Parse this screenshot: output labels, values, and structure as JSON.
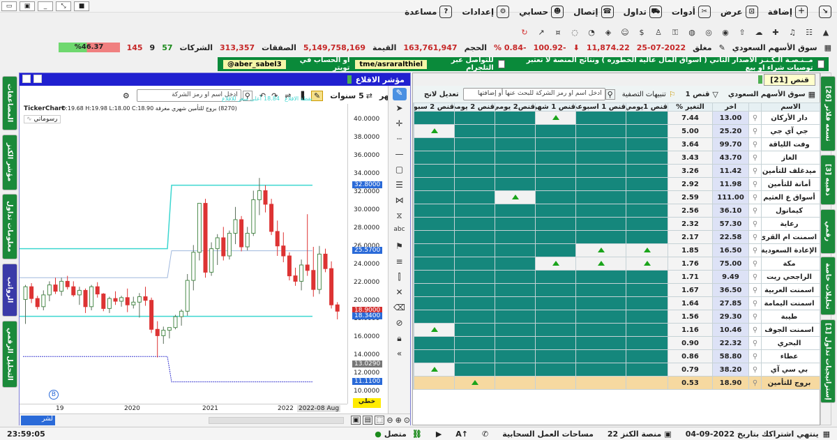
{
  "menu": [
    {
      "label": "إضافة",
      "icon": "add-icon"
    },
    {
      "label": "عرض",
      "icon": "view-icon"
    },
    {
      "label": "أدوات",
      "icon": "tools-icon"
    },
    {
      "label": "تداول",
      "icon": "cart-icon"
    },
    {
      "label": "إتصال",
      "icon": "phone-icon"
    },
    {
      "label": "حسابي",
      "icon": "user-icon"
    },
    {
      "label": "إعدادات",
      "icon": "gear-icon"
    },
    {
      "label": "مساعدة",
      "icon": "help-icon"
    }
  ],
  "market": {
    "name": "سوق الأسهم السعودي",
    "status": "مغلق",
    "date": "25-07-2022",
    "index": "11,874.22",
    "change": "-100.92",
    "change_pct": "-0.84 %",
    "volume_label": "الحجم",
    "volume": "163,761,947",
    "value_label": "القيمة",
    "value": "5,149,758,169",
    "trades_label": "الصفقات",
    "trades": "313,357",
    "companies_label": "الشركات",
    "up": "57",
    "flat": "9",
    "down": "145",
    "ratio": "%46.37"
  },
  "banner": {
    "text1": "مــنـصـة الـكـنـز الاصدار الثاني ( أسواق المال عالية الخطوره ) ونتائج المنصة لا تعتبر توصيات شراء او بيع",
    "text2": "للتواصل عبر التلجرام",
    "tg": "tme/asraralthiel",
    "text3": "او الحساب في تويتر",
    "tw": "aber_sabel3@"
  },
  "left_tabs": [
    "المضاعفات",
    "مؤشر الكنز",
    "معلومات تداول",
    "الرواتب",
    "التحليل الرقمي"
  ],
  "right_tabs": [
    "تسعه فلاتر [26]",
    "ذهبيه [3]",
    "رقمي",
    "تحليلات خاصة",
    "إستراتيجيات تداول [1]"
  ],
  "chart": {
    "title": "مؤشر الاقلاع",
    "search_placeholder": "ادخل اسم او رمز الشركة",
    "period_label": "5 سنوات",
    "interval_label": "شهر",
    "info": "(8270) بروج للتأمين شهري مغرقة O:19.68 H:19.98 L:18.00 C:18.90",
    "brand": "TickerChart",
    "legend": "رسوماتي",
    "ind_labels": [
      "أعلى سعر للاقلاع",
      "نقطة الاقلاع",
      "18.84"
    ],
    "y_ticks": [
      "40.0000",
      "38.0000",
      "36.0000",
      "34.0000",
      "32.0000",
      "30.0000",
      "28.0000",
      "26.0000",
      "24.0000",
      "22.0000",
      "20.0000",
      "18.0000",
      "16.0000",
      "14.0000",
      "12.0000",
      "10.0000"
    ],
    "price_tags": [
      {
        "v": "32.8000",
        "c": "#2a6ad8"
      },
      {
        "v": "25.5700",
        "c": "#2a6ad8"
      },
      {
        "v": "18.9000",
        "c": "#d32f2f"
      },
      {
        "v": "18.3400",
        "c": "#2a6ad8"
      },
      {
        "v": "13.0290",
        "c": "#777"
      },
      {
        "v": "11.1100",
        "c": "#2a6ad8"
      }
    ],
    "x_labels": [
      "19",
      "2020",
      "2021",
      "2022",
      "2022-08 Aug"
    ],
    "linear_label": "خطي",
    "bottom_label": "لشر",
    "b_marker": "B"
  },
  "table": {
    "tab_title": "قنص [21]",
    "market_select": "سوق الأسهم السعودي",
    "filter_label": "قنص 1",
    "alerts_label": "تنبيهات التصفية",
    "search_placeholder": "ادخل اسم او رمز الشركة للبحث عنها أو إضافتها",
    "edit_label": "تعديل لانح",
    "columns": [
      "الاسم",
      "",
      "آخر",
      "التغير %",
      "قنص 1يومي",
      "قنص 1 اسبوعي",
      "قنص 1 شهر",
      "قنص2 يومي",
      "قنص 2 يومي",
      "قنص 2 سبوع",
      "قنص"
    ],
    "rows": [
      {
        "name": "دار الأركان",
        "last": "13.00",
        "chg": "7.44",
        "cells": [
          0,
          0,
          1,
          0,
          0,
          0,
          0
        ]
      },
      {
        "name": "جي آي جي",
        "last": "25.20",
        "chg": "5.00",
        "cells": [
          0,
          0,
          0,
          0,
          0,
          1,
          0
        ]
      },
      {
        "name": "وفت اللياقة",
        "last": "99.70",
        "chg": "3.64",
        "cells": [
          0,
          0,
          0,
          0,
          0,
          0,
          0
        ]
      },
      {
        "name": "الغاز",
        "last": "43.70",
        "chg": "3.43",
        "cells": [
          0,
          0,
          0,
          0,
          0,
          0,
          0
        ]
      },
      {
        "name": "ميدغلف للتأمين",
        "last": "11.42",
        "chg": "3.26",
        "cells": [
          0,
          0,
          0,
          0,
          0,
          0,
          0
        ]
      },
      {
        "name": "أمانة للتأمين",
        "last": "11.98",
        "chg": "2.92",
        "cells": [
          0,
          0,
          0,
          0,
          0,
          0,
          0
        ]
      },
      {
        "name": "أسواق ع العثيم",
        "last": "111.00",
        "chg": "2.59",
        "cells": [
          0,
          0,
          0,
          1,
          0,
          0,
          0
        ]
      },
      {
        "name": "كيمانول",
        "last": "36.10",
        "chg": "2.56",
        "cells": [
          0,
          0,
          0,
          0,
          0,
          0,
          0
        ]
      },
      {
        "name": "رعاية",
        "last": "57.30",
        "chg": "2.32",
        "cells": [
          0,
          0,
          0,
          0,
          0,
          0,
          0
        ]
      },
      {
        "name": "اسمنت ام القرى",
        "last": "22.58",
        "chg": "2.17",
        "cells": [
          0,
          0,
          0,
          0,
          0,
          0,
          0
        ]
      },
      {
        "name": "الإعادة السعودية",
        "last": "16.50",
        "chg": "1.85",
        "cells": [
          2,
          2,
          0,
          0,
          0,
          0,
          0
        ]
      },
      {
        "name": "مكة",
        "last": "75.00",
        "chg": "1.76",
        "cells": [
          1,
          1,
          1,
          0,
          0,
          0,
          0
        ]
      },
      {
        "name": "الراجحي ريت",
        "last": "9.49",
        "chg": "1.71",
        "cells": [
          0,
          0,
          0,
          0,
          0,
          0,
          0
        ]
      },
      {
        "name": "اسمنت العربية",
        "last": "36.50",
        "chg": "1.67",
        "cells": [
          0,
          0,
          0,
          0,
          0,
          0,
          0
        ]
      },
      {
        "name": "اسمنت اليمامة",
        "last": "27.85",
        "chg": "1.64",
        "cells": [
          0,
          0,
          0,
          0,
          0,
          0,
          0
        ]
      },
      {
        "name": "طيبة",
        "last": "29.30",
        "chg": "1.56",
        "cells": [
          0,
          0,
          0,
          0,
          0,
          0,
          0
        ]
      },
      {
        "name": "اسمنت الجوف",
        "last": "10.46",
        "chg": "1.16",
        "cells": [
          0,
          0,
          0,
          0,
          0,
          1,
          0
        ]
      },
      {
        "name": "البحري",
        "last": "22.32",
        "chg": "0.90",
        "cells": [
          0,
          0,
          0,
          0,
          0,
          0,
          0
        ]
      },
      {
        "name": "عطاء",
        "last": "58.80",
        "chg": "0.86",
        "cells": [
          0,
          0,
          0,
          0,
          0,
          0,
          0
        ]
      },
      {
        "name": "بي سي آي",
        "last": "38.20",
        "chg": "0.79",
        "cells": [
          0,
          0,
          0,
          0,
          0,
          1,
          0
        ]
      },
      {
        "name": "بروج للتأمين",
        "last": "18.90",
        "chg": "0.53",
        "cells": [
          0,
          0,
          0,
          0,
          1,
          0,
          0
        ],
        "selected": true
      }
    ]
  },
  "status": {
    "subscription": "ينتهي اشتراكك بتاريخ 2022-09-04",
    "platform": "منصة الكنز 22",
    "cloud": "مساحات العمل السحابية",
    "connection": "متصل",
    "time": "23:59:05"
  },
  "colors": {
    "accent": "#15877c",
    "banner": "#0a8a3a",
    "chart_title": "#2020d0"
  }
}
